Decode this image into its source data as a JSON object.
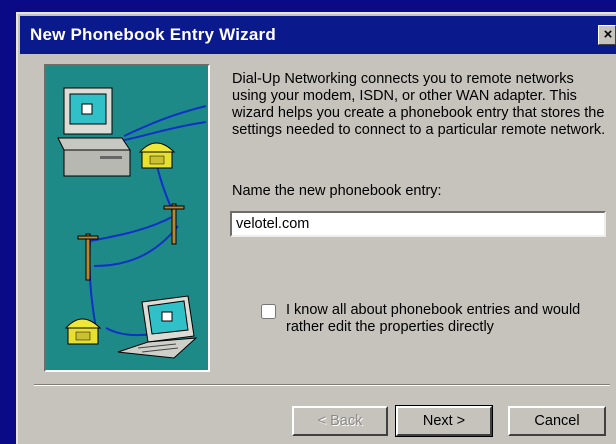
{
  "window": {
    "title": "New Phonebook Entry Wizard",
    "close_glyph": "×"
  },
  "intro": {
    "text": "Dial-Up Networking connects you to remote networks using your modem, ISDN, or other WAN adapter.  This wizard helps you create a phonebook entry that stores the settings needed to connect to a particular remote network."
  },
  "entry": {
    "label": "Name the new phonebook entry:",
    "value": "velotel.com"
  },
  "option": {
    "checked": false,
    "label": "I know all about phonebook entries and would rather edit the properties directly"
  },
  "buttons": {
    "back": "< Back",
    "next": "Next >",
    "cancel": "Cancel"
  },
  "colors": {
    "titlebar": "#0a1a8c",
    "face": "#c6c3bd",
    "art_background": "#1e8a88"
  }
}
